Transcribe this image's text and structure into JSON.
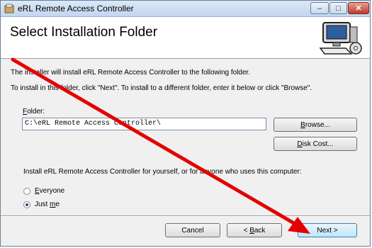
{
  "window": {
    "title": "eRL Remote Access Controller"
  },
  "header": {
    "title": "Select Installation Folder"
  },
  "body": {
    "intro": "The installer will install eRL Remote Access Controller to the following folder.",
    "instructions": "To install in this folder, click \"Next\". To install to a different folder, enter it below or click \"Browse\"."
  },
  "folder": {
    "label": "Folder:",
    "label_access": "F",
    "label_rest": "older:",
    "value": "C:\\eRL Remote Access Controller\\"
  },
  "buttons": {
    "browse_access": "B",
    "browse_rest": "rowse...",
    "disk_cost_access": "D",
    "disk_cost_rest": "isk Cost...",
    "cancel": "Cancel",
    "back_prefix": "< ",
    "back_access": "B",
    "back_rest": "ack",
    "next": "Next >"
  },
  "install_for": {
    "question": "Install eRL Remote Access Controller for yourself, or for anyone who uses this computer:",
    "options": [
      {
        "access": "E",
        "rest": "veryone",
        "checked": false
      },
      {
        "prefix": "Just ",
        "access": "m",
        "rest": "e",
        "checked": true
      }
    ]
  },
  "annotation": {
    "color": "#e50000"
  }
}
